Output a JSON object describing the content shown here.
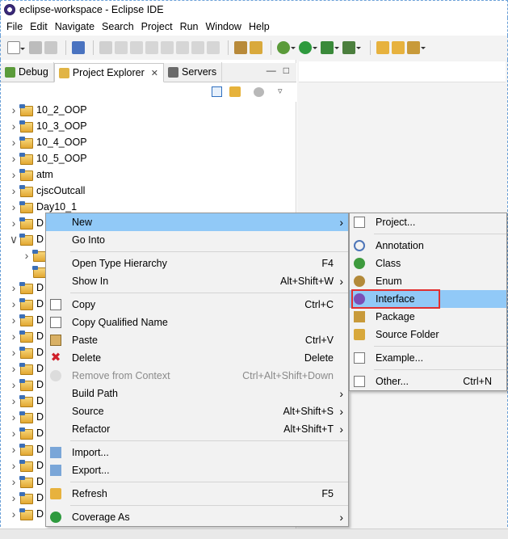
{
  "window": {
    "title": "eclipse-workspace - Eclipse IDE"
  },
  "menubar": [
    "File",
    "Edit",
    "Navigate",
    "Search",
    "Project",
    "Run",
    "Window",
    "Help"
  ],
  "tabs": [
    {
      "label": "Debug",
      "icon": "debug-icon"
    },
    {
      "label": "Project Explorer",
      "icon": "project-explorer-icon",
      "active": true
    },
    {
      "label": "Servers",
      "icon": "servers-icon"
    }
  ],
  "tree": [
    {
      "label": "10_2_OOP",
      "twisty": ">"
    },
    {
      "label": "10_3_OOP",
      "twisty": ">"
    },
    {
      "label": "10_4_OOP",
      "twisty": ">"
    },
    {
      "label": "10_5_OOP",
      "twisty": ">"
    },
    {
      "label": "atm",
      "twisty": ">"
    },
    {
      "label": "cjscOutcall",
      "twisty": ">"
    },
    {
      "label": "Day10_1",
      "twisty": ">"
    },
    {
      "label": "D",
      "twisty": ">"
    },
    {
      "label": "D",
      "twisty": "v"
    },
    {
      "label": "",
      "twisty": ">"
    },
    {
      "label": "",
      "twisty": ""
    },
    {
      "label": "D",
      "twisty": ">"
    },
    {
      "label": "D",
      "twisty": ">"
    },
    {
      "label": "D",
      "twisty": ">"
    },
    {
      "label": "D",
      "twisty": ">"
    },
    {
      "label": "D",
      "twisty": ">"
    },
    {
      "label": "D",
      "twisty": ">"
    },
    {
      "label": "D",
      "twisty": ">"
    },
    {
      "label": "D",
      "twisty": ">"
    },
    {
      "label": "D",
      "twisty": ">"
    },
    {
      "label": "D",
      "twisty": ">"
    },
    {
      "label": "D",
      "twisty": ">"
    },
    {
      "label": "D",
      "twisty": ">"
    },
    {
      "label": "D",
      "twisty": ">"
    },
    {
      "label": "D",
      "twisty": ">"
    },
    {
      "label": "D",
      "twisty": ">"
    }
  ],
  "context_menu": [
    {
      "label": "New",
      "accel": "",
      "submenu": true,
      "selected": true
    },
    {
      "label": "Go Into",
      "accel": ""
    },
    {
      "sep": true
    },
    {
      "label": "Open Type Hierarchy",
      "accel": "F4"
    },
    {
      "label": "Show In",
      "accel": "Alt+Shift+W",
      "submenu": true
    },
    {
      "sep": true
    },
    {
      "label": "Copy",
      "accel": "Ctrl+C",
      "icon": "copy-icon"
    },
    {
      "label": "Copy Qualified Name",
      "accel": "",
      "icon": "copy-qualified-icon"
    },
    {
      "label": "Paste",
      "accel": "Ctrl+V",
      "icon": "paste-icon"
    },
    {
      "label": "Delete",
      "accel": "Delete",
      "icon": "delete-icon"
    },
    {
      "label": "Remove from Context",
      "accel": "Ctrl+Alt+Shift+Down",
      "disabled": true,
      "icon": "remove-context-icon"
    },
    {
      "label": "Build Path",
      "accel": "",
      "submenu": true
    },
    {
      "label": "Source",
      "accel": "Alt+Shift+S",
      "submenu": true
    },
    {
      "label": "Refactor",
      "accel": "Alt+Shift+T",
      "submenu": true
    },
    {
      "sep": true
    },
    {
      "label": "Import...",
      "accel": "",
      "icon": "import-icon"
    },
    {
      "label": "Export...",
      "accel": "",
      "icon": "export-icon"
    },
    {
      "sep": true
    },
    {
      "label": "Refresh",
      "accel": "F5",
      "icon": "refresh-icon"
    },
    {
      "sep": true
    },
    {
      "label": "Coverage As",
      "accel": "",
      "submenu": true,
      "icon": "coverage-icon"
    }
  ],
  "new_submenu": [
    {
      "label": "Project...",
      "accel": "",
      "icon": "new-project-icon"
    },
    {
      "sep": true
    },
    {
      "label": "Annotation",
      "accel": "",
      "icon": "annotation-icon"
    },
    {
      "label": "Class",
      "accel": "",
      "icon": "class-icon"
    },
    {
      "label": "Enum",
      "accel": "",
      "icon": "enum-icon"
    },
    {
      "label": "Interface",
      "accel": "",
      "icon": "interface-icon",
      "selected": true,
      "highlighted": true
    },
    {
      "label": "Package",
      "accel": "",
      "icon": "package-icon"
    },
    {
      "label": "Source Folder",
      "accel": "",
      "icon": "source-folder-icon"
    },
    {
      "sep": true
    },
    {
      "label": "Example...",
      "accel": "",
      "icon": "example-icon"
    },
    {
      "sep": true
    },
    {
      "label": "Other...",
      "accel": "Ctrl+N",
      "icon": "other-icon"
    }
  ],
  "colors": {
    "selection": "#91c9f7",
    "highlight_box": "#e03030",
    "menu_bg": "#f2f2f2"
  }
}
